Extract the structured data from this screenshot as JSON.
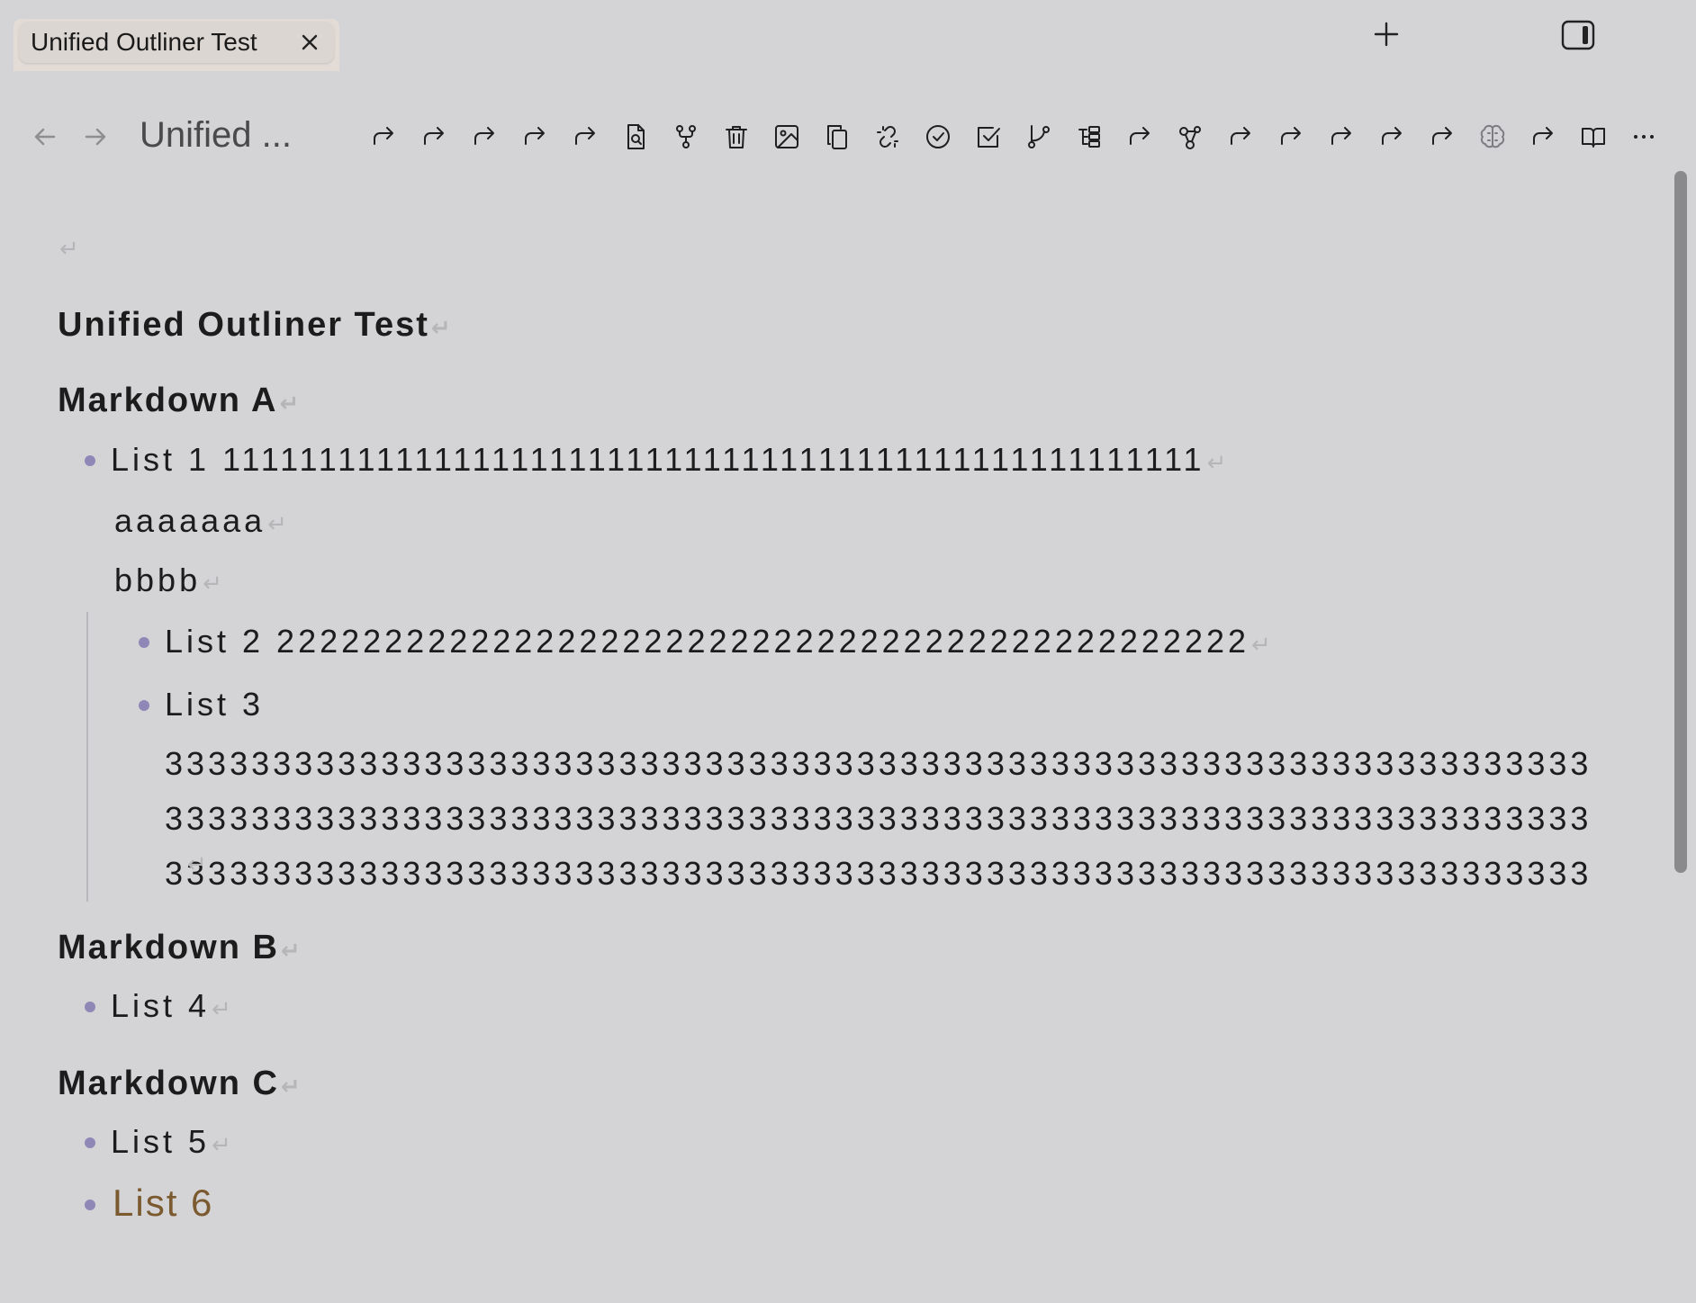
{
  "tabbar": {
    "active_tab_label": "Unified Outliner Test",
    "close_icon": "close-icon",
    "new_tab_icon": "plus-icon",
    "sidebar_icon": "sidebar-toggle-icon"
  },
  "toolbar": {
    "back_icon": "arrow-left-icon",
    "forward_icon": "arrow-right-icon",
    "file_title": "Unified ...",
    "icons": [
      "redo-icon",
      "redo-icon",
      "redo-icon",
      "redo-icon",
      "redo-icon",
      "file-search-icon",
      "fork-icon",
      "trash-icon",
      "image-icon",
      "copy-icon",
      "broken-link-icon",
      "check-circle-icon",
      "check-square-icon",
      "git-branch-icon",
      "tree-icon",
      "redo-icon",
      "graph-icon",
      "redo-icon",
      "redo-icon",
      "redo-icon",
      "redo-icon",
      "redo-icon",
      "brain-icon",
      "redo-icon",
      "book-open-icon",
      "more-icon"
    ]
  },
  "editor": {
    "return_symbol": "↵",
    "title": "Unified Outliner Test",
    "sections": [
      {
        "heading": "Markdown A",
        "list1": "List 1 111111111111111111111111111111111111111111111111111",
        "cont1": "aaaaaaa",
        "cont2": "bbbb",
        "list2": "List 2 222222222222222222222222222222222222222222222",
        "list3_head": "List 3",
        "list3_body": "3333333333333333333333333333333333333333333333333333333333333333333333333333333333333333333333333333333333333333333333333333333333333333333333333333333333333333333333333333333333333333333333333333333333333333333333333333333333333333333333333333333333333333333333333333333333333333333333333333333333333333333333333333333333333333333333333333333333333333333333333333333333333333333333333333333333333333333333333333333"
      },
      {
        "heading": "Markdown B",
        "list4": "List 4"
      },
      {
        "heading": "Markdown C",
        "list5": "List 5",
        "list6": "List 6"
      }
    ]
  },
  "colors": {
    "background": "#d4d3d6",
    "bullet": "#8f88b7",
    "list6_text": "#7a5a2e",
    "return_symbol": "#b6b5b8"
  }
}
